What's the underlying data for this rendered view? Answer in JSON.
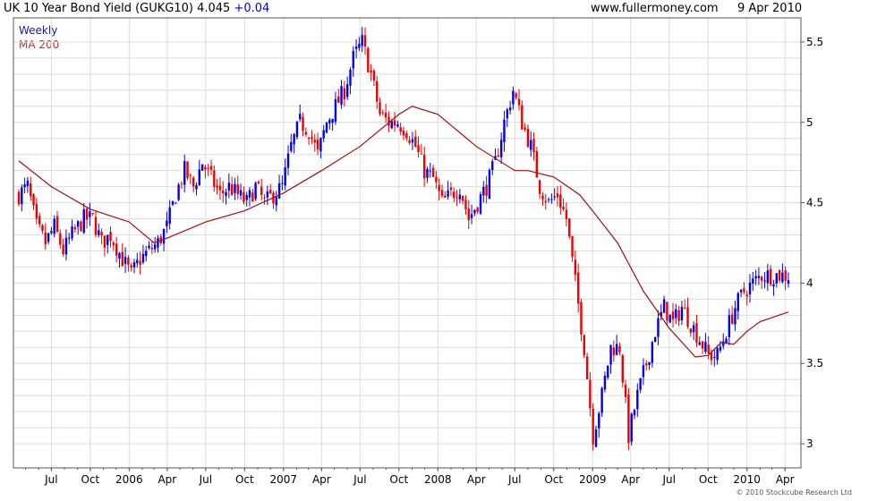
{
  "header": {
    "title_prefix": "UK 10 Year Bond Yield (GUKG10) 4.045",
    "change": "+0.04",
    "site": "www.fullermoney.com",
    "date": "9 Apr 2010"
  },
  "legend": {
    "weekly": "Weekly",
    "ma": "MA 200"
  },
  "credit": "© 2010 Stockcube Research Ltd",
  "colors": {
    "up": "#0000ee",
    "down": "#ee0000",
    "ma": "#a01010",
    "grid": "#dcdcdc",
    "weekly_label": "#1a1aa8",
    "ma_label": "#b03030",
    "change": "#0000cc"
  },
  "chart_data": {
    "type": "candlestick",
    "frequency": "weekly",
    "x_range": [
      "2005-04-15",
      "2010-04-09"
    ],
    "y_range": [
      2.85,
      5.65
    ],
    "y_ticks": [
      3,
      3.5,
      4,
      4.5,
      5,
      5.5
    ],
    "y_tick_labels": [
      "3",
      "3.5",
      "4",
      "4.5",
      "5",
      "5.5"
    ],
    "x_ticks": [
      {
        "label": "Jul",
        "date": "2005-07-01"
      },
      {
        "label": "Oct",
        "date": "2005-10-01"
      },
      {
        "label": "2006",
        "date": "2006-01-01"
      },
      {
        "label": "Apr",
        "date": "2006-04-01"
      },
      {
        "label": "Jul",
        "date": "2006-07-01"
      },
      {
        "label": "Oct",
        "date": "2006-10-01"
      },
      {
        "label": "2007",
        "date": "2007-01-01"
      },
      {
        "label": "Apr",
        "date": "2007-04-01"
      },
      {
        "label": "Jul",
        "date": "2007-07-01"
      },
      {
        "label": "Oct",
        "date": "2007-10-01"
      },
      {
        "label": "2008",
        "date": "2008-01-01"
      },
      {
        "label": "Apr",
        "date": "2008-04-01"
      },
      {
        "label": "Jul",
        "date": "2008-07-01"
      },
      {
        "label": "Oct",
        "date": "2008-10-01"
      },
      {
        "label": "2009",
        "date": "2009-01-01"
      },
      {
        "label": "Apr",
        "date": "2009-04-01"
      },
      {
        "label": "Jul",
        "date": "2009-07-01"
      },
      {
        "label": "Oct",
        "date": "2009-10-01"
      },
      {
        "label": "2010",
        "date": "2010-01-01"
      },
      {
        "label": "Apr",
        "date": "2010-04-01"
      }
    ],
    "close_anchors": [
      [
        "2005-04-15",
        4.55
      ],
      [
        "2005-05-06",
        4.6
      ],
      [
        "2005-05-27",
        4.35
      ],
      [
        "2005-06-17",
        4.25
      ],
      [
        "2005-07-08",
        4.35
      ],
      [
        "2005-07-29",
        4.2
      ],
      [
        "2005-08-19",
        4.3
      ],
      [
        "2005-09-16",
        4.4
      ],
      [
        "2005-10-07",
        4.4
      ],
      [
        "2005-10-28",
        4.25
      ],
      [
        "2005-11-18",
        4.3
      ],
      [
        "2005-12-16",
        4.15
      ],
      [
        "2006-01-06",
        4.05
      ],
      [
        "2006-01-27",
        4.15
      ],
      [
        "2006-02-17",
        4.2
      ],
      [
        "2006-03-10",
        4.25
      ],
      [
        "2006-03-31",
        4.35
      ],
      [
        "2006-04-21",
        4.55
      ],
      [
        "2006-05-12",
        4.7
      ],
      [
        "2006-06-02",
        4.6
      ],
      [
        "2006-06-23",
        4.75
      ],
      [
        "2006-07-14",
        4.65
      ],
      [
        "2006-08-04",
        4.55
      ],
      [
        "2006-08-25",
        4.6
      ],
      [
        "2006-09-15",
        4.55
      ],
      [
        "2006-10-06",
        4.5
      ],
      [
        "2006-10-27",
        4.6
      ],
      [
        "2006-11-17",
        4.5
      ],
      [
        "2006-12-08",
        4.55
      ],
      [
        "2006-12-29",
        4.6
      ],
      [
        "2007-01-19",
        4.85
      ],
      [
        "2007-02-09",
        5.0
      ],
      [
        "2007-03-02",
        4.95
      ],
      [
        "2007-03-23",
        4.8
      ],
      [
        "2007-04-13",
        5.0
      ],
      [
        "2007-05-04",
        5.1
      ],
      [
        "2007-05-25",
        5.2
      ],
      [
        "2007-06-15",
        5.4
      ],
      [
        "2007-07-06",
        5.5
      ],
      [
        "2007-07-27",
        5.3
      ],
      [
        "2007-08-17",
        5.05
      ],
      [
        "2007-09-07",
        5.0
      ],
      [
        "2007-09-28",
        5.0
      ],
      [
        "2007-10-19",
        4.95
      ],
      [
        "2007-11-09",
        4.85
      ],
      [
        "2007-11-30",
        4.7
      ],
      [
        "2007-12-21",
        4.65
      ],
      [
        "2008-01-11",
        4.5
      ],
      [
        "2008-02-01",
        4.55
      ],
      [
        "2008-02-22",
        4.6
      ],
      [
        "2008-03-14",
        4.4
      ],
      [
        "2008-04-04",
        4.5
      ],
      [
        "2008-04-25",
        4.6
      ],
      [
        "2008-05-16",
        4.75
      ],
      [
        "2008-06-06",
        5.0
      ],
      [
        "2008-06-27",
        5.2
      ],
      [
        "2008-07-18",
        5.0
      ],
      [
        "2008-08-08",
        4.85
      ],
      [
        "2008-08-29",
        4.6
      ],
      [
        "2008-09-19",
        4.5
      ],
      [
        "2008-10-10",
        4.55
      ],
      [
        "2008-10-31",
        4.4
      ],
      [
        "2008-11-21",
        4.0
      ],
      [
        "2008-12-12",
        3.6
      ],
      [
        "2009-01-02",
        3.05
      ],
      [
        "2009-01-23",
        3.3
      ],
      [
        "2009-02-13",
        3.6
      ],
      [
        "2009-03-06",
        3.6
      ],
      [
        "2009-03-27",
        3.05
      ],
      [
        "2009-04-17",
        3.3
      ],
      [
        "2009-05-08",
        3.5
      ],
      [
        "2009-05-29",
        3.7
      ],
      [
        "2009-06-19",
        3.85
      ],
      [
        "2009-07-10",
        3.75
      ],
      [
        "2009-07-31",
        3.85
      ],
      [
        "2009-08-21",
        3.75
      ],
      [
        "2009-09-11",
        3.65
      ],
      [
        "2009-10-02",
        3.55
      ],
      [
        "2009-10-23",
        3.55
      ],
      [
        "2009-11-13",
        3.7
      ],
      [
        "2009-12-04",
        3.85
      ],
      [
        "2009-12-25",
        3.95
      ],
      [
        "2010-01-15",
        4.0
      ],
      [
        "2010-02-05",
        4.05
      ],
      [
        "2010-02-26",
        4.05
      ],
      [
        "2010-03-19",
        4.05
      ],
      [
        "2010-04-09",
        4.045
      ]
    ],
    "series": [
      {
        "name": "Weekly",
        "style": "candlestick"
      },
      {
        "name": "MA 200",
        "style": "line",
        "points": [
          [
            "2005-04-15",
            4.76
          ],
          [
            "2005-07-01",
            4.6
          ],
          [
            "2005-10-01",
            4.46
          ],
          [
            "2006-01-01",
            4.38
          ],
          [
            "2006-03-01",
            4.25
          ],
          [
            "2006-04-01",
            4.28
          ],
          [
            "2006-07-01",
            4.38
          ],
          [
            "2006-10-01",
            4.45
          ],
          [
            "2007-01-01",
            4.56
          ],
          [
            "2007-04-01",
            4.7
          ],
          [
            "2007-07-01",
            4.85
          ],
          [
            "2007-10-01",
            5.05
          ],
          [
            "2007-11-01",
            5.1
          ],
          [
            "2008-01-01",
            5.05
          ],
          [
            "2008-04-01",
            4.85
          ],
          [
            "2008-07-01",
            4.7
          ],
          [
            "2008-08-01",
            4.7
          ],
          [
            "2008-10-01",
            4.66
          ],
          [
            "2008-12-01",
            4.55
          ],
          [
            "2009-01-01",
            4.45
          ],
          [
            "2009-03-01",
            4.25
          ],
          [
            "2009-05-01",
            3.95
          ],
          [
            "2009-07-01",
            3.72
          ],
          [
            "2009-09-01",
            3.54
          ],
          [
            "2009-10-01",
            3.55
          ],
          [
            "2009-11-01",
            3.63
          ],
          [
            "2009-12-01",
            3.62
          ],
          [
            "2010-01-01",
            3.7
          ],
          [
            "2010-02-01",
            3.76
          ],
          [
            "2010-04-09",
            3.82
          ]
        ]
      }
    ],
    "grid": true,
    "y_axis_side": "right"
  }
}
